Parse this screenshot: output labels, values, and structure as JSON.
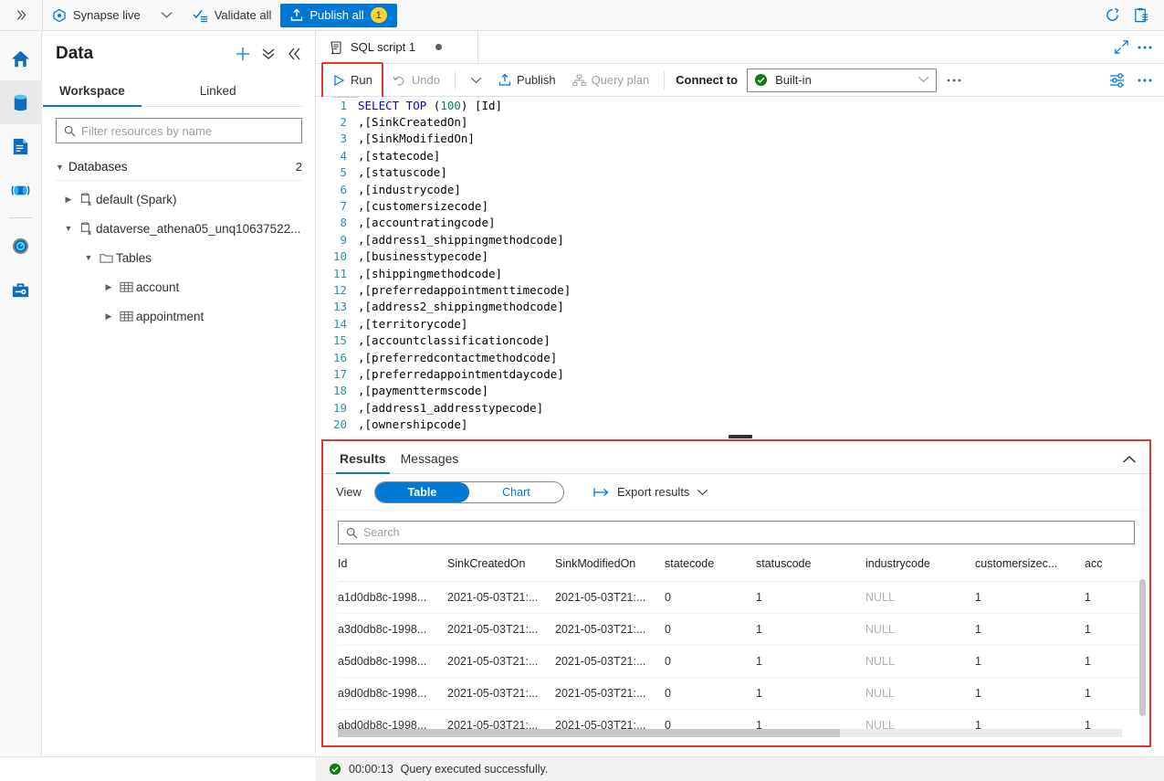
{
  "topbar": {
    "expand_icon": "chevron-double-right-icon",
    "mode_label": "Synapse live",
    "mode_icon": "synapse-icon",
    "mode_chevron": "chevron-down-icon",
    "validate_label": "Validate all",
    "validate_icon": "validate-icon",
    "publish_label": "Publish all",
    "publish_icon": "publish-upload-icon",
    "publish_badge": "1",
    "publish_color": "#0078d4",
    "badge_color": "#ffd335",
    "refresh_icon": "refresh-icon",
    "feedback_icon": "clipboard-notes-icon"
  },
  "rail": {
    "items": [
      {
        "name": "home",
        "icon": "home-icon",
        "active": false
      },
      {
        "name": "data",
        "icon": "database-cylinder-icon",
        "active": true
      },
      {
        "name": "develop",
        "icon": "document-icon",
        "active": false
      },
      {
        "name": "integrate",
        "icon": "pipeline-icon",
        "active": false
      },
      {
        "name": "monitor",
        "icon": "gauge-icon",
        "active": false
      },
      {
        "name": "manage",
        "icon": "toolbox-icon",
        "active": false
      }
    ]
  },
  "data_pane": {
    "title": "Data",
    "actions": [
      {
        "name": "add",
        "icon": "plus-icon"
      },
      {
        "name": "actions",
        "icon": "chevron-double-down-icon"
      },
      {
        "name": "collapse",
        "icon": "chevron-double-left-icon"
      }
    ],
    "tabs": [
      {
        "label": "Workspace",
        "active": true
      },
      {
        "label": "Linked",
        "active": false
      }
    ],
    "filter_placeholder": "Filter resources by name",
    "search_icon": "search-icon",
    "group": {
      "label": "Databases",
      "count": "2",
      "expanded": true
    },
    "tree": [
      {
        "label": "default (Spark)",
        "level": 1,
        "expanded": false,
        "icon": "database-icon"
      },
      {
        "label": "dataverse_athena05_unq10637522...",
        "level": 1,
        "expanded": true,
        "icon": "database-icon"
      },
      {
        "label": "Tables",
        "level": 2,
        "expanded": true,
        "icon": "folder-icon"
      },
      {
        "label": "account",
        "level": 3,
        "expanded": false,
        "icon": "table-icon"
      },
      {
        "label": "appointment",
        "level": 3,
        "expanded": false,
        "icon": "table-icon"
      }
    ]
  },
  "editor_tab": {
    "label": "SQL script 1",
    "icon": "sql-script-icon",
    "dirty": true,
    "maximize_icon": "expand-diagonal-icon",
    "more_icon": "ellipsis-icon"
  },
  "command_bar": {
    "run_label": "Run",
    "run_icon": "play-triangle-icon",
    "run_highlight_color": "#e8342c",
    "undo_label": "Undo",
    "undo_icon": "undo-arrow-icon",
    "undo_chevron": "chevron-down-icon",
    "publish_label": "Publish",
    "publish_icon": "publish-upload-icon",
    "query_plan_label": "Query plan",
    "query_plan_icon": "query-plan-icon",
    "connect_to_label": "Connect to",
    "connect_value": "Built-in",
    "connect_status_icon": "green-check-circle-icon",
    "connect_chevron": "chevron-down-icon",
    "more_icon": "ellipsis-icon",
    "settings_icon": "sliders-icon",
    "overflow_icon": "ellipsis-icon"
  },
  "code": {
    "lines": [
      {
        "n": "1",
        "text": "SELECT TOP (100) [Id]"
      },
      {
        "n": "2",
        "text": ",[SinkCreatedOn]"
      },
      {
        "n": "3",
        "text": ",[SinkModifiedOn]"
      },
      {
        "n": "4",
        "text": ",[statecode]"
      },
      {
        "n": "5",
        "text": ",[statuscode]"
      },
      {
        "n": "6",
        "text": ",[industrycode]"
      },
      {
        "n": "7",
        "text": ",[customersizecode]"
      },
      {
        "n": "8",
        "text": ",[accountratingcode]"
      },
      {
        "n": "9",
        "text": ",[address1_shippingmethodcode]"
      },
      {
        "n": "10",
        "text": ",[businesstypecode]"
      },
      {
        "n": "11",
        "text": ",[shippingmethodcode]"
      },
      {
        "n": "12",
        "text": ",[preferredappointmenttimecode]"
      },
      {
        "n": "13",
        "text": ",[address2_shippingmethodcode]"
      },
      {
        "n": "14",
        "text": ",[territorycode]"
      },
      {
        "n": "15",
        "text": ",[accountclassificationcode]"
      },
      {
        "n": "16",
        "text": ",[preferredcontactmethodcode]"
      },
      {
        "n": "17",
        "text": ",[preferredappointmentdaycode]"
      },
      {
        "n": "18",
        "text": ",[paymenttermscode]"
      },
      {
        "n": "19",
        "text": ",[address1_addresstypecode]"
      },
      {
        "n": "20",
        "text": ",[ownershipcode]"
      }
    ],
    "first_line_keyword": "SELECT TOP",
    "first_line_number": "100",
    "first_line_tail": " [Id]"
  },
  "results": {
    "highlight_color": "#e8342c",
    "tabs": [
      {
        "label": "Results",
        "active": true
      },
      {
        "label": "Messages",
        "active": false
      }
    ],
    "collapse_icon": "chevron-up-icon",
    "view_label": "View",
    "view_options": [
      {
        "label": "Table",
        "selected": true
      },
      {
        "label": "Chart",
        "selected": false
      }
    ],
    "export_label": "Export results",
    "export_icon": "export-arrow-icon",
    "export_chevron": "chevron-down-icon",
    "search_placeholder": "Search",
    "search_icon": "search-icon",
    "columns": [
      "Id",
      "SinkCreatedOn",
      "SinkModifiedOn",
      "statecode",
      "statuscode",
      "industrycode",
      "customersizec...",
      "acc"
    ],
    "rows": [
      [
        "a1d0db8c-1998...",
        "2021-05-03T21:...",
        "2021-05-03T21:...",
        "0",
        "1",
        "NULL",
        "1",
        "1"
      ],
      [
        "a3d0db8c-1998...",
        "2021-05-03T21:...",
        "2021-05-03T21:...",
        "0",
        "1",
        "NULL",
        "1",
        "1"
      ],
      [
        "a5d0db8c-1998...",
        "2021-05-03T21:...",
        "2021-05-03T21:...",
        "0",
        "1",
        "NULL",
        "1",
        "1"
      ],
      [
        "a9d0db8c-1998...",
        "2021-05-03T21:...",
        "2021-05-03T21:...",
        "0",
        "1",
        "NULL",
        "1",
        "1"
      ],
      [
        "abd0db8c-1998...",
        "2021-05-03T21:...",
        "2021-05-03T21:...",
        "0",
        "1",
        "NULL",
        "1",
        "1"
      ]
    ]
  },
  "status_bar": {
    "icon": "green-check-circle-icon",
    "duration": "00:00:13",
    "message": "Query executed successfully."
  }
}
